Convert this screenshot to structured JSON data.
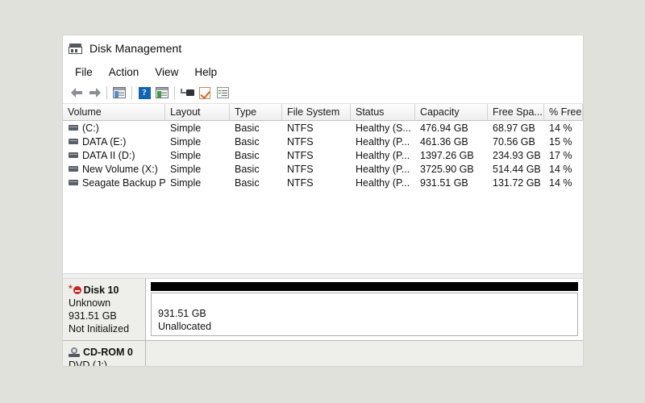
{
  "window": {
    "title": "Disk Management",
    "icon": "disk-management-icon"
  },
  "menu": {
    "items": [
      {
        "label": "File"
      },
      {
        "label": "Action"
      },
      {
        "label": "View"
      },
      {
        "label": "Help"
      }
    ]
  },
  "toolbar": {
    "buttons": [
      {
        "name": "back-button",
        "icon": "arrow-left-icon"
      },
      {
        "name": "forward-button",
        "icon": "arrow-right-icon"
      },
      {
        "name": "show-hide-console-tree-button",
        "icon": "console-tree-icon"
      },
      {
        "name": "help-button",
        "icon": "help-question-icon"
      },
      {
        "name": "show-hide-action-pane-button",
        "icon": "action-pane-icon"
      },
      {
        "name": "rescan-disks-button",
        "icon": "plug-icon"
      },
      {
        "name": "properties-button",
        "icon": "checkmark-page-icon"
      },
      {
        "name": "list-view-button",
        "icon": "checklist-icon"
      }
    ]
  },
  "volume_table": {
    "columns": [
      {
        "key": "volume",
        "label": "Volume"
      },
      {
        "key": "layout",
        "label": "Layout"
      },
      {
        "key": "type",
        "label": "Type"
      },
      {
        "key": "file_system",
        "label": "File System"
      },
      {
        "key": "status",
        "label": "Status"
      },
      {
        "key": "capacity",
        "label": "Capacity"
      },
      {
        "key": "free_space",
        "label": "Free Spa..."
      },
      {
        "key": "pct_free",
        "label": "% Free"
      }
    ],
    "rows": [
      {
        "volume": "(C:)",
        "layout": "Simple",
        "type": "Basic",
        "file_system": "NTFS",
        "status": "Healthy (S...",
        "capacity": "476.94 GB",
        "free_space": "68.97 GB",
        "pct_free": "14 %"
      },
      {
        "volume": "DATA (E:)",
        "layout": "Simple",
        "type": "Basic",
        "file_system": "NTFS",
        "status": "Healthy (P...",
        "capacity": "461.36 GB",
        "free_space": "70.56 GB",
        "pct_free": "15 %"
      },
      {
        "volume": "DATA II (D:)",
        "layout": "Simple",
        "type": "Basic",
        "file_system": "NTFS",
        "status": "Healthy (P...",
        "capacity": "1397.26 GB",
        "free_space": "234.93 GB",
        "pct_free": "17 %"
      },
      {
        "volume": "New Volume (X:)",
        "layout": "Simple",
        "type": "Basic",
        "file_system": "NTFS",
        "status": "Healthy (P...",
        "capacity": "3725.90 GB",
        "free_space": "514.44 GB",
        "pct_free": "14 %"
      },
      {
        "volume": "Seagate Backup Pl...",
        "layout": "Simple",
        "type": "Basic",
        "file_system": "NTFS",
        "status": "Healthy (P...",
        "capacity": "931.51 GB",
        "free_space": "131.72 GB",
        "pct_free": "14 %"
      }
    ]
  },
  "graphical_view": {
    "disks": [
      {
        "name": "Disk 10",
        "status_icon": "error-circle-icon",
        "type": "Unknown",
        "size": "931.51 GB",
        "state": "Not Initialized",
        "partition": {
          "size": "931.51 GB",
          "label": "Unallocated"
        }
      }
    ],
    "cdrom": {
      "name": "CD-ROM 0",
      "media": "DVD (J:)"
    }
  },
  "colors": {
    "desktop_background": "#dfe1da",
    "window_background": "#f0f0f0",
    "pane_background": "#ffffff",
    "error_red": "#cc2222",
    "unallocated_strip": "#000000",
    "accent_blue": "#1263b0"
  }
}
